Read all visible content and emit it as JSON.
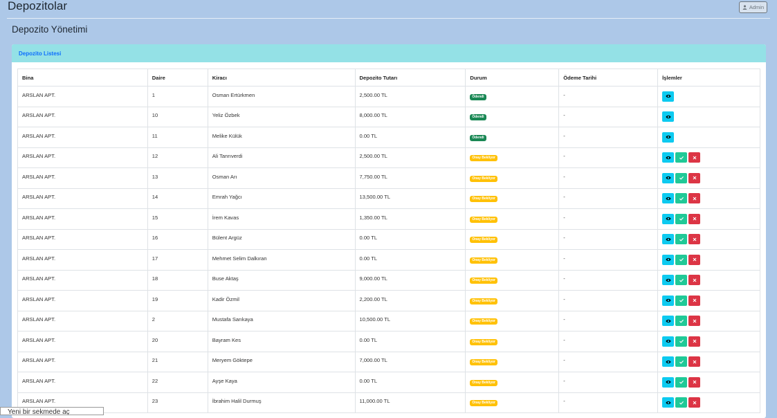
{
  "header": {
    "title": "Depozitolar",
    "user_label": "Admin"
  },
  "section_title": "Depozito Yönetimi",
  "card": {
    "title": "Depozito Listesi"
  },
  "table": {
    "columns": [
      "Bina",
      "Daire",
      "Kiracı",
      "Depozito Tutarı",
      "Durum",
      "Ödeme Tarihi",
      "İşlemler"
    ],
    "rows": [
      {
        "bina": "ARSLAN APT.",
        "daire": "1",
        "kiraci": "Osman Ertürkmen",
        "tutar": "2,500.00 TL",
        "durum": "Ödendi",
        "status": "paid",
        "tarih": "-"
      },
      {
        "bina": "ARSLAN APT.",
        "daire": "10",
        "kiraci": "Yeliz Özbek",
        "tutar": "8,000.00 TL",
        "durum": "Ödendi",
        "status": "paid",
        "tarih": "-"
      },
      {
        "bina": "ARSLAN APT.",
        "daire": "11",
        "kiraci": "Melike Külük",
        "tutar": "0.00 TL",
        "durum": "Ödendi",
        "status": "paid",
        "tarih": "-"
      },
      {
        "bina": "ARSLAN APT.",
        "daire": "12",
        "kiraci": "Ali Tanrıverdi",
        "tutar": "2,500.00 TL",
        "durum": "Onay Bekliyor",
        "status": "pending",
        "tarih": "-"
      },
      {
        "bina": "ARSLAN APT.",
        "daire": "13",
        "kiraci": "Osman Arı",
        "tutar": "7,750.00 TL",
        "durum": "Onay Bekliyor",
        "status": "pending",
        "tarih": "-"
      },
      {
        "bina": "ARSLAN APT.",
        "daire": "14",
        "kiraci": "Emrah Yağcı",
        "tutar": "13,500.00 TL",
        "durum": "Onay Bekliyor",
        "status": "pending",
        "tarih": "-"
      },
      {
        "bina": "ARSLAN APT.",
        "daire": "15",
        "kiraci": "İrem Kavas",
        "tutar": "1,350.00 TL",
        "durum": "Onay Bekliyor",
        "status": "pending",
        "tarih": "-"
      },
      {
        "bina": "ARSLAN APT.",
        "daire": "16",
        "kiraci": "Bülent Argüz",
        "tutar": "0.00 TL",
        "durum": "Onay Bekliyor",
        "status": "pending",
        "tarih": "-"
      },
      {
        "bina": "ARSLAN APT.",
        "daire": "17",
        "kiraci": "Mehmet Selim Dalkıran",
        "tutar": "0.00 TL",
        "durum": "Onay Bekliyor",
        "status": "pending",
        "tarih": "-"
      },
      {
        "bina": "ARSLAN APT.",
        "daire": "18",
        "kiraci": "Buse Aktaş",
        "tutar": "9,000.00 TL",
        "durum": "Onay Bekliyor",
        "status": "pending",
        "tarih": "-"
      },
      {
        "bina": "ARSLAN APT.",
        "daire": "19",
        "kiraci": "Kadir Özmil",
        "tutar": "2,200.00 TL",
        "durum": "Onay Bekliyor",
        "status": "pending",
        "tarih": "-"
      },
      {
        "bina": "ARSLAN APT.",
        "daire": "2",
        "kiraci": "Mustafa Sarıkaya",
        "tutar": "10,500.00 TL",
        "durum": "Onay Bekliyor",
        "status": "pending",
        "tarih": "-"
      },
      {
        "bina": "ARSLAN APT.",
        "daire": "20",
        "kiraci": "Bayram Kes",
        "tutar": "0.00 TL",
        "durum": "Onay Bekliyor",
        "status": "pending",
        "tarih": "-"
      },
      {
        "bina": "ARSLAN APT.",
        "daire": "21",
        "kiraci": "Meryem Göktepe",
        "tutar": "7,000.00 TL",
        "durum": "Onay Bekliyor",
        "status": "pending",
        "tarih": "-"
      },
      {
        "bina": "ARSLAN APT.",
        "daire": "22",
        "kiraci": "Ayşe Kaya",
        "tutar": "0.00 TL",
        "durum": "Onay Bekliyor",
        "status": "pending",
        "tarih": "-"
      },
      {
        "bina": "ARSLAN APT.",
        "daire": "23",
        "kiraci": "İbrahim Halil Durmuş",
        "tutar": "11,000.00 TL",
        "durum": "Onay Bekliyor",
        "status": "pending",
        "tarih": "-"
      }
    ]
  },
  "icons": {
    "view": "eye-icon",
    "approve": "check-icon",
    "reject": "x-icon",
    "user": "user-icon"
  },
  "colors": {
    "page_bg": "#adc8e8",
    "card_header": "#94e1e6",
    "paid": "#198754",
    "pending": "#ffc107",
    "view_btn": "#0dcaf0",
    "approve_btn": "#20c997",
    "reject_btn": "#dc3545"
  },
  "status_bar": {
    "text": "Yeni bir sekmede aç"
  }
}
